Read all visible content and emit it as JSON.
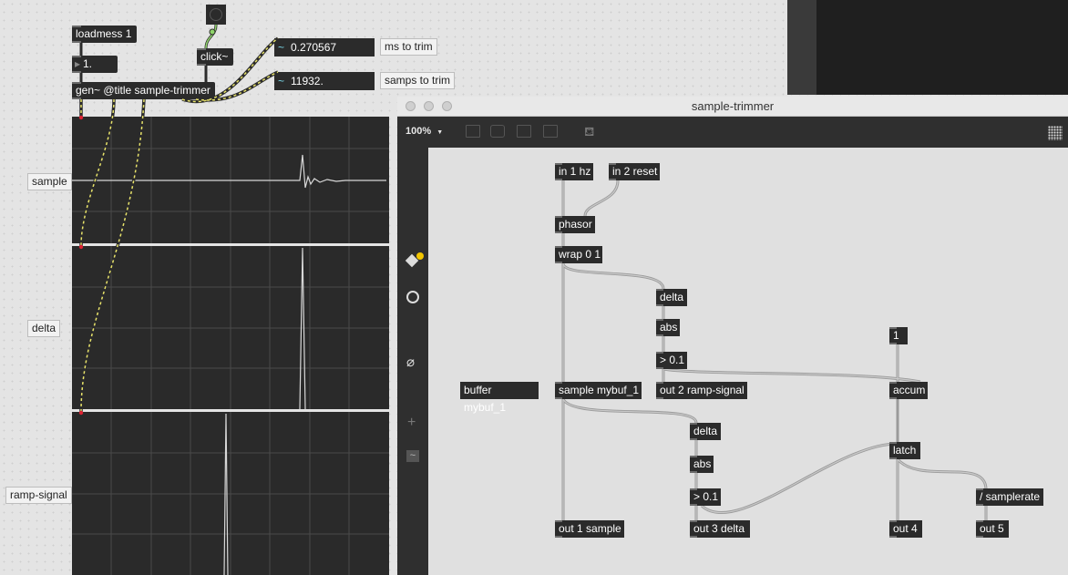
{
  "main_patch": {
    "loadmess": "loadmess 1",
    "number": "1.",
    "click": "click~",
    "gen": "gen~ @title sample-trimmer",
    "ms_value": "0.270567",
    "ms_label": "ms to trim",
    "samps_value": "11932.",
    "samps_label": "samps to trim",
    "scope_labels": [
      "sample",
      "delta",
      "ramp-signal"
    ]
  },
  "gen_window": {
    "title": "sample-trimmer",
    "zoom": "100%",
    "zoom_arrow": "▼",
    "objects": {
      "in1": "in 1 hz",
      "in2": "in 2 reset",
      "phasor": "phasor",
      "wrap": "wrap 0 1",
      "delta1": "delta",
      "abs1": "abs",
      "gt1": "> 0.1",
      "one": "1",
      "buffer": "buffer mybuf_1",
      "sample": "sample mybuf_1",
      "out2": "out 2 ramp-signal",
      "accum": "accum",
      "delta2": "delta",
      "latch": "latch",
      "abs2": "abs",
      "gt2": "> 0.1",
      "sr": "/ samplerate",
      "out1": "out 1 sample",
      "out3": "out 3 delta",
      "out4": "out 4",
      "out5": "out 5"
    }
  },
  "colors": {
    "patch_bg": "#e4e4e4",
    "object_bg": "#2b2b2b",
    "scope_bg": "#2a2a2a",
    "wire_signal": "#8fd46a",
    "wire_gen": "#9a9a9a",
    "accent_yellow": "#f2c500"
  }
}
